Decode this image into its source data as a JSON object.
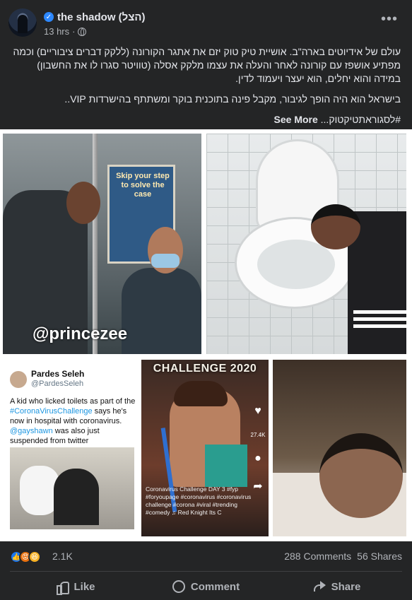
{
  "post": {
    "author": "the shadow (הצל)",
    "time": "13 hrs",
    "more": "•••",
    "paragraphs": [
      "עולם של אידיוטים בארה\"ב. אושיית טיק טוק יזם את אתגר הקורונה (ללקק דברים ציבוריים) וכמה מפתיע אושפז עם קורונה לאחר והעלה את עצמו מלקק אסלה (טוויטר סגרו לו את החשבון) במידה והוא יחלים, הוא יעצר ויעמוד לדין.",
      "בישראל הוא היה הופך לגיבור, מקבל פינה בתוכנית בוקר ומשתתף בהישרדות VIP.."
    ],
    "hashtag": "#לסגוראתטיקטוק...",
    "see_more": "See More"
  },
  "images": {
    "watermark": "@princezee",
    "subway_sign": "Skip your step to solve the case",
    "tweet": {
      "name": "Pardes Seleh",
      "handle": "@PardesSeleh",
      "text_a": "A kid who licked toilets as part of the ",
      "tag1": "#CoronaVirusChallenge",
      "text_b": " says he's now in hospital with coronavirus. ",
      "tag2": "@gayshawn",
      "text_c": " was also just suspended from twitter"
    },
    "tiktok": {
      "banner": "CHALLENGE 2020",
      "caption": "Coronavirus Challenge DAY 3 #fyp #foryoupage #coronavirus #coronavirus challenge #corona #viral #trending #comedy ♫ Red Knight Its C",
      "likes": "27.4K"
    }
  },
  "stats": {
    "reactions_count": "2.1K",
    "comments": "288 Comments",
    "shares": "56 Shares"
  },
  "actions": {
    "like": "Like",
    "comment": "Comment",
    "share": "Share"
  }
}
